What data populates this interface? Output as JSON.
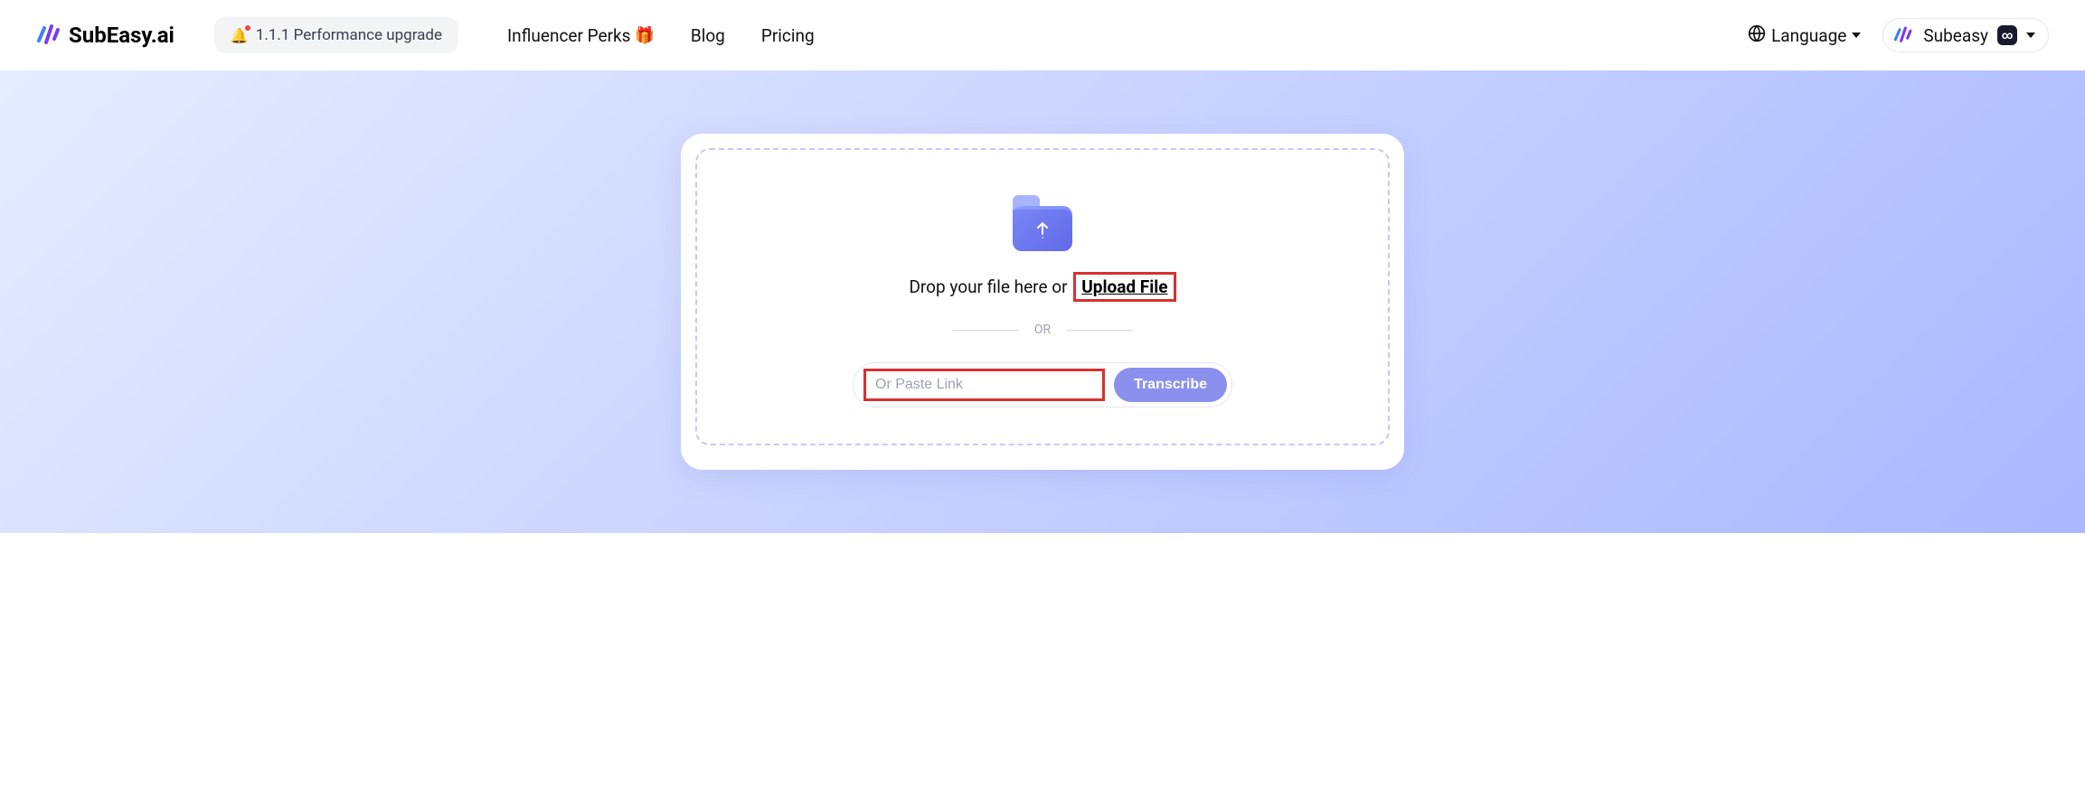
{
  "header": {
    "brand": "SubEasy.ai",
    "version_badge": "1.1.1 Performance upgrade",
    "nav": {
      "influencer": "Influencer Perks",
      "blog": "Blog",
      "pricing": "Pricing"
    },
    "language_label": "Language",
    "user_name": "Subeasy",
    "user_badge": "∞"
  },
  "upload": {
    "drop_prefix": "Drop your file here or ",
    "upload_link": "Upload File",
    "or_label": "OR",
    "link_placeholder": "Or Paste Link",
    "transcribe_label": "Transcribe"
  }
}
